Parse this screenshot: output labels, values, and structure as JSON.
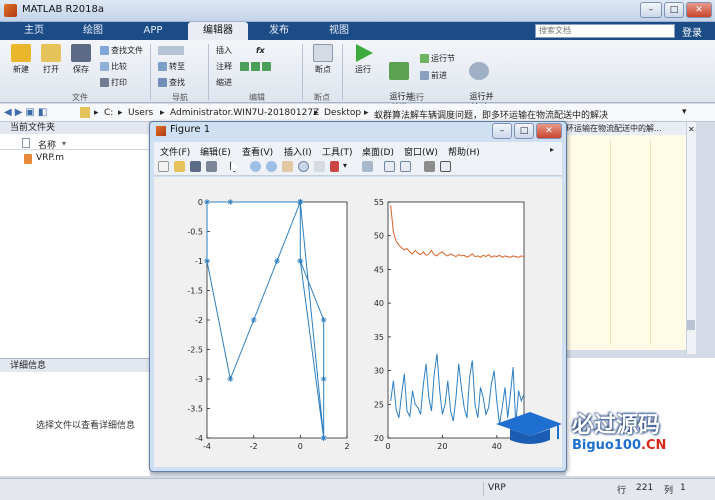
{
  "app": {
    "title": "MATLAB R2018a"
  },
  "window_controls": {
    "minimize": "–",
    "maximize": "□",
    "close": "✕"
  },
  "tabs": [
    {
      "label": "主页"
    },
    {
      "label": "绘图"
    },
    {
      "label": "APP"
    },
    {
      "label": "编辑器"
    },
    {
      "label": "发布"
    },
    {
      "label": "视图"
    }
  ],
  "search": {
    "placeholder": "搜索文档"
  },
  "login": "登录",
  "ribbon": {
    "file": {
      "new": "新建",
      "open": "打开",
      "save": "保存",
      "find_files": "查找文件",
      "compare": "比较",
      "print": "打印",
      "group": "文件"
    },
    "nav": {
      "goto": "转至",
      "find": "查找",
      "group": "导航"
    },
    "edit": {
      "insert": "插入",
      "fx": "fx",
      "comment": "注释",
      "indent": "缩进",
      "group": "编辑"
    },
    "breakpoints": {
      "breakpoint": "断点",
      "group": "断点"
    },
    "run": {
      "run": "运行",
      "run_advance": "运行并\n前进",
      "run_section": "运行节",
      "advance": "前进",
      "run_time": "运行并\n计时",
      "group": "运行"
    }
  },
  "address": {
    "crumbs": [
      "C:",
      "Users",
      "Administrator.WIN7U-20180127Z",
      "Desktop",
      "蚁群算法解车辆调度问题，即多环运输在物流配送中的解决"
    ]
  },
  "current_folder": {
    "header": "当前文件夹",
    "col_name": "名称",
    "files": [
      "VRP.m"
    ]
  },
  "details": {
    "header": "详细信息",
    "hint": "选择文件以查看详细信息"
  },
  "editor_strip": "环运输在物流配送中的解...",
  "status": {
    "file": "VRP",
    "row_label": "行",
    "row": "221",
    "col_label": "列",
    "col": "1"
  },
  "figure": {
    "title": "Figure 1",
    "menu": [
      "文件(F)",
      "编辑(E)",
      "查看(V)",
      "插入(I)",
      "工具(T)",
      "桌面(D)",
      "窗口(W)",
      "帮助(H)"
    ]
  },
  "watermark": {
    "main": "必过源码",
    "sub": "Biguo100",
    "sub_suffix": ".CN"
  },
  "chart_data": [
    {
      "type": "line",
      "title": "",
      "xlabel": "",
      "ylabel": "",
      "xlim": [
        -4,
        2
      ],
      "ylim": [
        -4,
        0
      ],
      "xticks": [
        "-4",
        "-2",
        "0",
        "2"
      ],
      "yticks": [
        "0",
        "-0.5",
        "-1",
        "-1.5",
        "-2",
        "-2.5",
        "-3",
        "-3.5",
        "-4"
      ],
      "series": [
        {
          "color": "#2e7ebf",
          "marker": "star",
          "x": [
            0,
            -4,
            -4,
            -3,
            -2,
            -1,
            0,
            0,
            1,
            1,
            1,
            0,
            0,
            1,
            0,
            -3,
            0
          ],
          "y": [
            0,
            0,
            -1,
            -3,
            -2,
            -1,
            0,
            -1,
            -2,
            -3,
            -4,
            0,
            -1,
            -4,
            0,
            0,
            0
          ]
        }
      ]
    },
    {
      "type": "line",
      "title": "",
      "xlabel": "",
      "ylabel": "",
      "xlim": [
        0,
        50
      ],
      "ylim": [
        20,
        55
      ],
      "xticks": [
        "0",
        "20",
        "40"
      ],
      "yticks": [
        "55",
        "50",
        "45",
        "40",
        "35",
        "30",
        "25",
        "20"
      ],
      "series": [
        {
          "color": "#d9622b",
          "x": [
            1,
            2,
            3,
            4,
            5,
            6,
            7,
            8,
            9,
            10,
            11,
            12,
            13,
            14,
            15,
            16,
            17,
            18,
            19,
            20,
            21,
            22,
            23,
            24,
            25,
            26,
            27,
            28,
            29,
            30,
            31,
            32,
            33,
            34,
            35,
            36,
            37,
            38,
            39,
            40,
            41,
            42,
            43,
            44,
            45,
            46,
            47,
            48,
            49,
            50
          ],
          "y": [
            54.5,
            50.5,
            49.2,
            48.6,
            48.2,
            47.9,
            48.1,
            47.6,
            47.3,
            47.8,
            47.4,
            47.2,
            47.6,
            47.1,
            47.3,
            47.8,
            47.2,
            47.0,
            47.4,
            47.6,
            47.2,
            47.0,
            47.3,
            47.1,
            46.9,
            47.2,
            47.0,
            47.1,
            46.8,
            47.0,
            47.3,
            46.9,
            47.0,
            46.8,
            47.1,
            46.9,
            47.2,
            46.8,
            47.0,
            46.9,
            47.1,
            46.8,
            47.0,
            46.9,
            46.8,
            47.0,
            46.9,
            46.8,
            47.0,
            46.9
          ]
        },
        {
          "color": "#2e7ebf",
          "x": [
            1,
            2,
            3,
            4,
            5,
            6,
            7,
            8,
            9,
            10,
            11,
            12,
            13,
            14,
            15,
            16,
            17,
            18,
            19,
            20,
            21,
            22,
            23,
            24,
            25,
            26,
            27,
            28,
            29,
            30,
            31,
            32,
            33,
            34,
            35,
            36,
            37,
            38,
            39,
            40,
            41,
            42,
            43,
            44,
            45,
            46,
            47,
            48,
            49,
            50
          ],
          "y": [
            25.5,
            28.5,
            24.2,
            23.0,
            26.5,
            29.5,
            24.0,
            23.2,
            27.0,
            25.0,
            24.5,
            23.5,
            28.0,
            31.0,
            26.0,
            24.0,
            29.5,
            32.5,
            27.0,
            23.5,
            25.0,
            28.5,
            24.0,
            22.5,
            26.0,
            31.0,
            27.5,
            24.5,
            23.0,
            29.0,
            31.5,
            25.0,
            23.0,
            27.5,
            26.0,
            23.5,
            24.5,
            28.0,
            30.0,
            25.5,
            22.0,
            24.5,
            27.5,
            23.0,
            26.5,
            30.5,
            22.0,
            27.0,
            25.5,
            26.5
          ]
        }
      ]
    }
  ]
}
